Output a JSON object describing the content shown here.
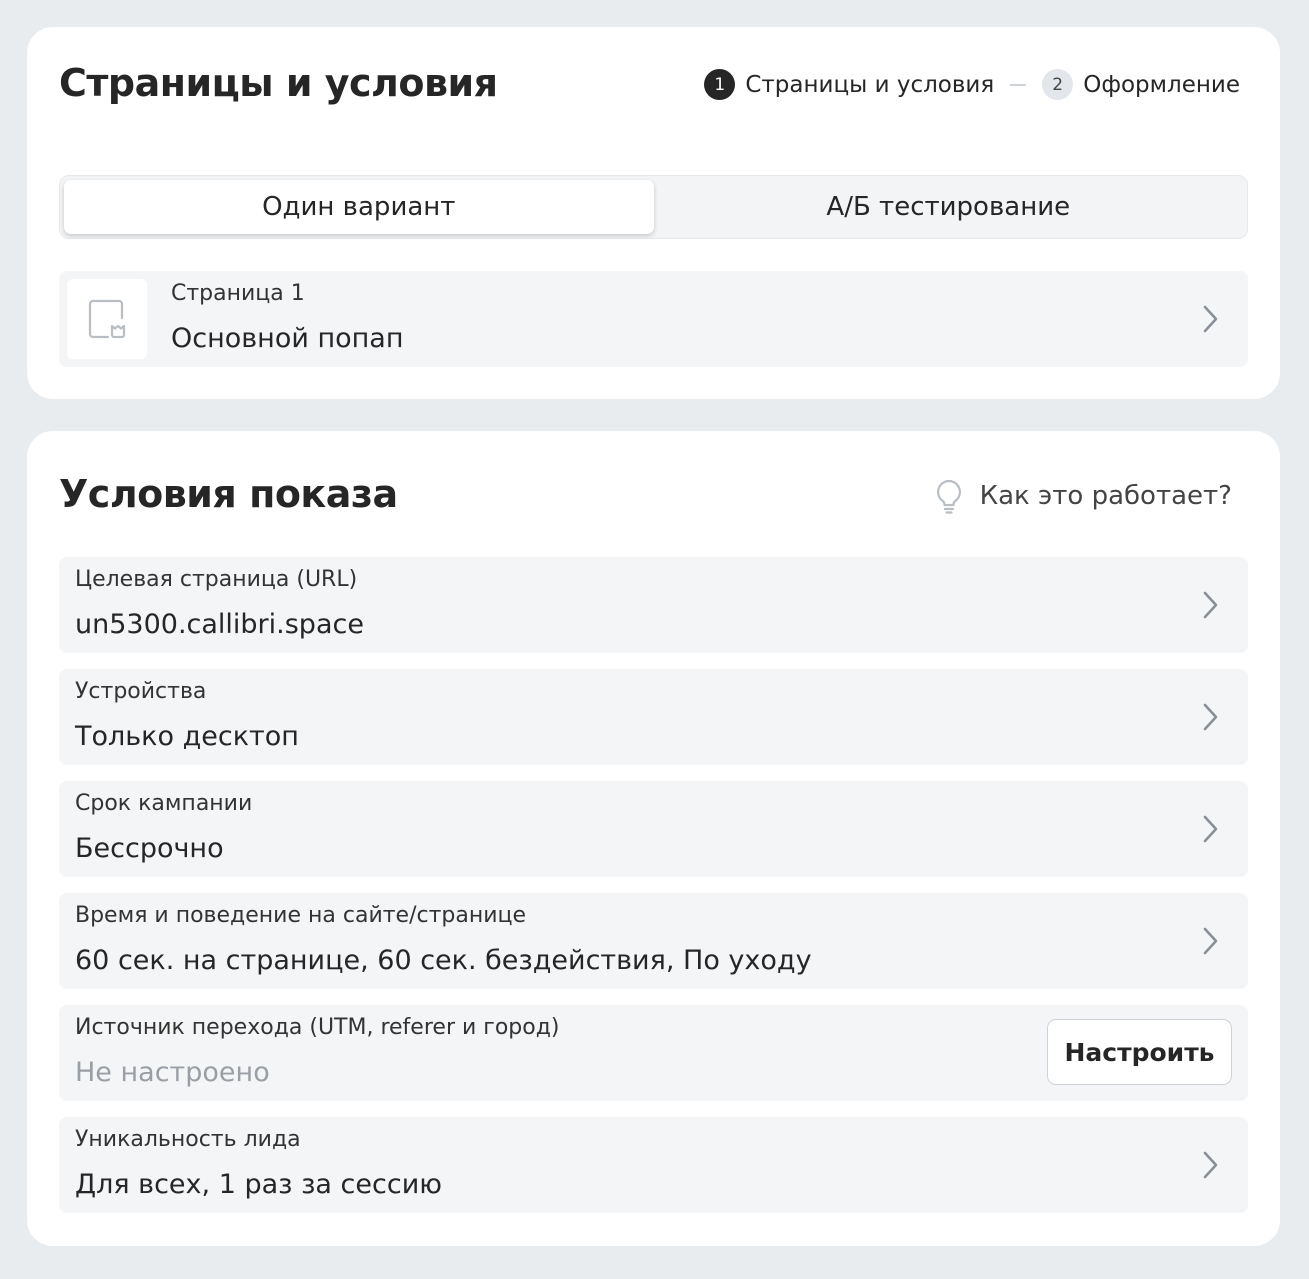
{
  "pages_card": {
    "title": "Страницы и условия",
    "stepper": [
      {
        "num": "1",
        "label": "Страницы и условия"
      },
      {
        "num": "2",
        "label": "Оформление"
      }
    ],
    "segmented": {
      "options": [
        "Один вариант",
        "А/Б тестирование"
      ],
      "selected": "Один вариант"
    },
    "page": {
      "label": "Страница 1",
      "value": "Основной попап"
    }
  },
  "conditions_card": {
    "title": "Условия показа",
    "help_link": "Как это работает?",
    "rows": [
      {
        "label": "Целевая страница (URL)",
        "value": "un5300.callibri.space"
      },
      {
        "label": "Устройства",
        "value": "Только десктоп"
      },
      {
        "label": "Срок кампании",
        "value": "Бессрочно"
      },
      {
        "label": "Время и поведение на сайте/странице",
        "value": "60 сек. на странице, 60 сек. бездействия, По уходу"
      },
      {
        "label": "Источник перехода (UTM, referer и город)",
        "value": "Не настроено",
        "button": "Настроить"
      },
      {
        "label": "Уникальность лида",
        "value": "Для всех, 1 раз за сессию"
      }
    ]
  },
  "icons": {
    "page_thumb": "popup-page-icon",
    "chevron": "chevron-right-icon",
    "help": "lightbulb-icon"
  },
  "colors": {
    "background": "#e9ecef",
    "card": "#ffffff",
    "row": "#f4f5f7",
    "text": "#262626",
    "muted": "#9a9fa6",
    "step_active": "#262626"
  }
}
